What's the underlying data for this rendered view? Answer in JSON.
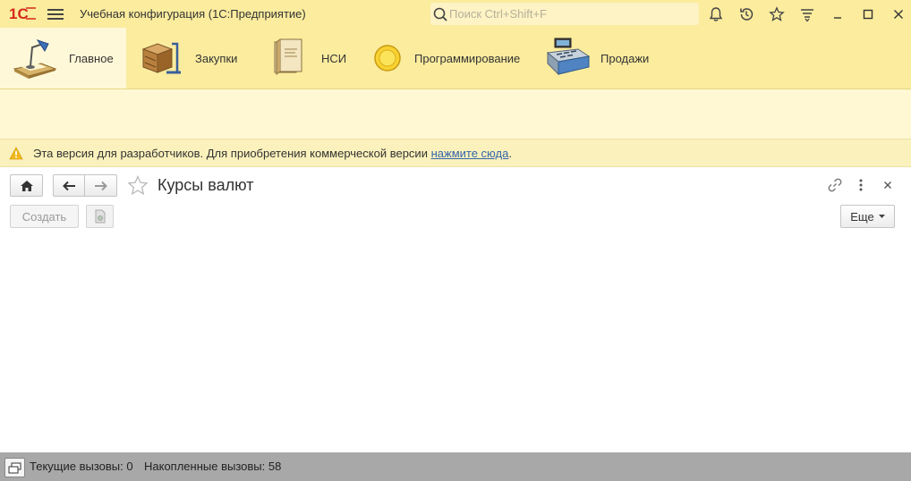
{
  "titlebar": {
    "logo_text": "1С",
    "menu_icon": "hamburger-icon",
    "app_title": "Учебная конфигурация  (1С:Предприятие)",
    "search_placeholder": "Поиск Ctrl+Shift+F",
    "icons": [
      "bell-icon",
      "history-icon",
      "star-icon",
      "filter-menu-icon",
      "minimize-icon",
      "maximize-icon",
      "close-icon"
    ]
  },
  "sections": [
    {
      "label": "Главное",
      "icon": "desk-lamp-icon",
      "active": true
    },
    {
      "label": "Закупки",
      "icon": "boxes-icon",
      "active": false
    },
    {
      "label": "НСИ",
      "icon": "books-icon",
      "active": false
    },
    {
      "label": "Программирование",
      "icon": "sun-icon",
      "active": false
    },
    {
      "label": "Продажи",
      "icon": "cash-register-icon",
      "active": false
    }
  ],
  "notice": {
    "text": "Эта версия для разработчиков. Для приобретения коммерческой версии",
    "link": "нажмите сюда",
    "suffix": ".",
    "icon": "warning-icon"
  },
  "form": {
    "title": "Курсы валют",
    "create_label": "Создать",
    "more_label": "Еще",
    "icons": [
      "home-icon",
      "back-arrow-icon",
      "forward-arrow-icon",
      "favorite-star-icon",
      "link-icon",
      "more-vertical-icon",
      "close-form-icon",
      "document-icon"
    ]
  },
  "statusbar": {
    "current_calls": "Текущие вызовы: 0",
    "accumulated_calls": "Накопленные вызовы: 58",
    "icon": "windows-icon"
  },
  "colors": {
    "titlebar_bg": "#fbec9e",
    "section_active_bg": "#fff8d8",
    "function_panel_bg": "#fff8d3",
    "statusbar_bg": "#a8a8a8",
    "link": "#3366aa",
    "logo_red": "#d42a1c",
    "warning": "#f2b81b"
  }
}
